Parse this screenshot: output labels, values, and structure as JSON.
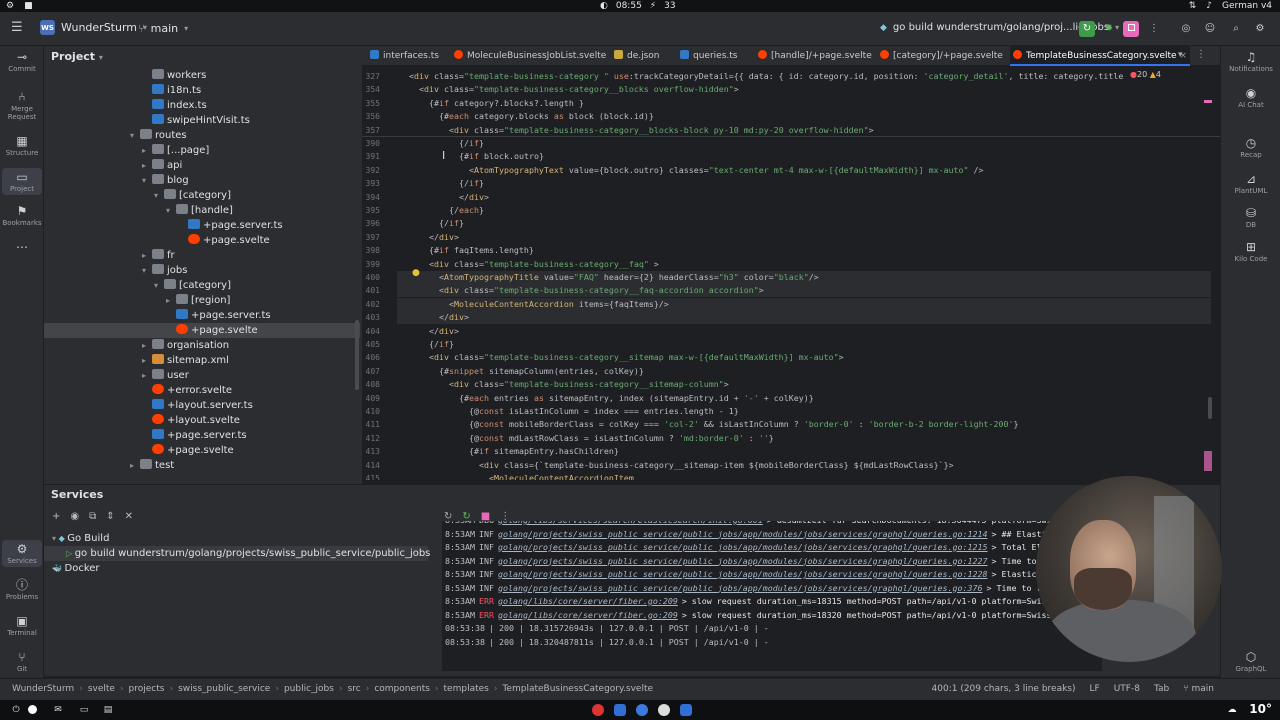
{
  "os_bar": {
    "time": "08:55",
    "counter": "33",
    "keyboard": "German v4"
  },
  "header": {
    "project_badge": "WS",
    "project_name": "WunderSturm",
    "branch": "main",
    "run_config": "go build wunderstrum/golang/proj...lic_jobs"
  },
  "left_tools": [
    {
      "label": "Commit",
      "icon": "commit-icon"
    },
    {
      "label": "Merge Request",
      "icon": "merge-request-icon"
    },
    {
      "label": "Structure",
      "icon": "structure-icon"
    },
    {
      "label": "Project",
      "icon": "folder-icon"
    },
    {
      "label": "Bookmarks",
      "icon": "bookmark-icon"
    }
  ],
  "left_tools_bottom": [
    {
      "label": "Services",
      "icon": "services-icon"
    },
    {
      "label": "Problems",
      "icon": "problems-icon"
    },
    {
      "label": "Terminal",
      "icon": "terminal-icon"
    },
    {
      "label": "Git",
      "icon": "git-icon"
    }
  ],
  "right_tools": [
    {
      "label": "Notifications",
      "icon": "bell-icon"
    },
    {
      "label": "AI Chat",
      "icon": "ai-chat-icon"
    },
    {
      "label": "Recap",
      "icon": "recap-icon"
    },
    {
      "label": "PlantUML",
      "icon": "plantuml-icon"
    },
    {
      "label": "DB",
      "icon": "database-icon"
    },
    {
      "label": "Kilo Code",
      "icon": "kilo-code-icon"
    },
    {
      "label": "GraphQL",
      "icon": "graphql-icon"
    }
  ],
  "project_panel": {
    "title": "Project",
    "tree": [
      {
        "label": "workers",
        "type": "folder",
        "indent": 1,
        "arrow": ""
      },
      {
        "label": "i18n.ts",
        "type": "ts",
        "indent": 1,
        "arrow": ""
      },
      {
        "label": "index.ts",
        "type": "ts",
        "indent": 1,
        "arrow": ""
      },
      {
        "label": "swipeHintVisit.ts",
        "type": "ts",
        "indent": 1,
        "arrow": ""
      },
      {
        "label": "routes",
        "type": "folder",
        "indent": 0,
        "arrow": "▾"
      },
      {
        "label": "[...page]",
        "type": "folder",
        "indent": 1,
        "arrow": "▸"
      },
      {
        "label": "api",
        "type": "folder",
        "indent": 1,
        "arrow": "▸"
      },
      {
        "label": "blog",
        "type": "folder",
        "indent": 1,
        "arrow": "▾"
      },
      {
        "label": "[category]",
        "type": "folder",
        "indent": 2,
        "arrow": "▾"
      },
      {
        "label": "[handle]",
        "type": "folder",
        "indent": 3,
        "arrow": "▾"
      },
      {
        "label": "+page.server.ts",
        "type": "ts",
        "indent": 4,
        "arrow": ""
      },
      {
        "label": "+page.svelte",
        "type": "svelte",
        "indent": 4,
        "arrow": ""
      },
      {
        "label": "fr",
        "type": "folder",
        "indent": 1,
        "arrow": "▸"
      },
      {
        "label": "jobs",
        "type": "folder",
        "indent": 1,
        "arrow": "▾"
      },
      {
        "label": "[category]",
        "type": "folder",
        "indent": 2,
        "arrow": "▾"
      },
      {
        "label": "[region]",
        "type": "folder",
        "indent": 3,
        "arrow": "▸"
      },
      {
        "label": "+page.server.ts",
        "type": "ts",
        "indent": 3,
        "arrow": ""
      },
      {
        "label": "+page.svelte",
        "type": "svelte",
        "indent": 3,
        "arrow": "",
        "selected": true
      },
      {
        "label": "organisation",
        "type": "folder",
        "indent": 1,
        "arrow": "▸"
      },
      {
        "label": "sitemap.xml",
        "type": "xml",
        "indent": 1,
        "arrow": "▸"
      },
      {
        "label": "user",
        "type": "folder",
        "indent": 1,
        "arrow": "▸"
      },
      {
        "label": "+error.svelte",
        "type": "svelte",
        "indent": 1,
        "arrow": ""
      },
      {
        "label": "+layout.server.ts",
        "type": "ts",
        "indent": 1,
        "arrow": ""
      },
      {
        "label": "+layout.svelte",
        "type": "svelte",
        "indent": 1,
        "arrow": ""
      },
      {
        "label": "+page.server.ts",
        "type": "ts",
        "indent": 1,
        "arrow": ""
      },
      {
        "label": "+page.svelte",
        "type": "svelte",
        "indent": 1,
        "arrow": ""
      },
      {
        "label": "test",
        "type": "folder",
        "indent": 0,
        "arrow": "▸"
      }
    ]
  },
  "tabs": [
    {
      "label": "interfaces.ts",
      "type": "ts"
    },
    {
      "label": "MoleculeBusinessJobList.svelte",
      "type": "svelte"
    },
    {
      "label": "de.json",
      "type": "json"
    },
    {
      "label": "queries.ts",
      "type": "ts"
    },
    {
      "label": "[handle]/+page.svelte",
      "type": "svelte"
    },
    {
      "label": "[category]/+page.svelte",
      "type": "svelte"
    },
    {
      "label": "TemplateBusinessCategory.svelte",
      "type": "svelte",
      "active": true
    }
  ],
  "editor": {
    "inspection_errors": "20",
    "inspection_warnings": "4",
    "lines": [
      {
        "n": "327",
        "indent": 0,
        "text": "<div class=\"template-business-category \" use:trackCategoryDetail={{ data: { id: category.id, position: 'category_detail', title: category.title"
      },
      {
        "n": "354",
        "indent": 1,
        "text": "<div class=\"template-business-category__blocks overflow-hidden\">"
      },
      {
        "n": "355",
        "indent": 2,
        "text": "{#if category?.blocks?.length }"
      },
      {
        "n": "356",
        "indent": 3,
        "text": "{#each category.blocks as block (block.id)}"
      },
      {
        "n": "357",
        "indent": 4,
        "text": "<div class=\"template-business-category__blocks-block py-10 md:py-20 overflow-hidden\">"
      },
      {
        "n": "390",
        "indent": 5,
        "text": "{/if}"
      },
      {
        "n": "391",
        "indent": 5,
        "text": "{#if block.outro}"
      },
      {
        "n": "392",
        "indent": 6,
        "text": "<AtomTypographyText value={block.outro} classes=\"text-center mt-4 max-w-[{defaultMaxWidth}] mx-auto\" />"
      },
      {
        "n": "393",
        "indent": 5,
        "text": "{/if}"
      },
      {
        "n": "394",
        "indent": 5,
        "text": "</div>"
      },
      {
        "n": "395",
        "indent": 4,
        "text": "{/each}"
      },
      {
        "n": "396",
        "indent": 3,
        "text": "{/if}"
      },
      {
        "n": "397",
        "indent": 2,
        "text": "</div>"
      },
      {
        "n": "398",
        "indent": 2,
        "text": "{#if faqItems.length}"
      },
      {
        "n": "399",
        "indent": 2,
        "text": "<div class=\"template-business-category__faq\" >"
      },
      {
        "n": "400",
        "indent": 3,
        "text": "<AtomTypographyTitle value=\"FAQ\" header={2} headerClass=\"h3\" color=\"black\"/>",
        "hl": true
      },
      {
        "n": "401",
        "indent": 3,
        "text": "<div class=\"template-business-category__faq-accordion accordion\">",
        "hl": true
      },
      {
        "n": "402",
        "indent": 4,
        "text": "<MoleculeContentAccordion items={faqItems}/>",
        "hl": true
      },
      {
        "n": "403",
        "indent": 3,
        "text": "</div>",
        "hl": true
      },
      {
        "n": "404",
        "indent": 2,
        "text": "</div>"
      },
      {
        "n": "405",
        "indent": 2,
        "text": "{/if}"
      },
      {
        "n": "406",
        "indent": 2,
        "text": "<div class=\"template-business-category__sitemap max-w-[{defaultMaxWidth}] mx-auto\">"
      },
      {
        "n": "407",
        "indent": 3,
        "text": "{#snippet sitemapColumn(entries, colKey)}"
      },
      {
        "n": "408",
        "indent": 4,
        "text": "<div class=\"template-business-category__sitemap-column\">"
      },
      {
        "n": "409",
        "indent": 5,
        "text": "{#each entries as sitemapEntry, index (sitemapEntry.id + '-' + colKey)}"
      },
      {
        "n": "410",
        "indent": 6,
        "text": "{@const isLastInColumn = index === entries.length - 1}"
      },
      {
        "n": "411",
        "indent": 6,
        "text": "{@const mobileBorderClass = colKey === 'col-2' && isLastInColumn ? 'border-0' : 'border-b-2 border-light-200'}"
      },
      {
        "n": "412",
        "indent": 6,
        "text": "{@const mdLastRowClass = isLastInColumn ? 'md:border-0' : ''}"
      },
      {
        "n": "413",
        "indent": 6,
        "text": "{#if sitemapEntry.hasChildren}"
      },
      {
        "n": "414",
        "indent": 7,
        "text": "<div class={`template-business-category__sitemap-item ${mobileBorderClass} ${mdLastRowClass}`}>"
      },
      {
        "n": "415",
        "indent": 8,
        "text": "<MoleculeContentAccordionItem"
      }
    ]
  },
  "services_panel": {
    "title": "Services",
    "items": [
      {
        "label": "Go Build",
        "indent": 0,
        "arrow": "▾"
      },
      {
        "label": "go build wunderstrum/golang/projects/swiss_public_service/public_jobs",
        "indent": 1,
        "arrow": "",
        "selected": true
      },
      {
        "label": "Docker",
        "indent": 0,
        "arrow": ""
      }
    ],
    "logs": [
      {
        "time": "8:53AM",
        "level": "DBG",
        "path": "golang/libs/services/search/elasticsearch/init.go:601",
        "msg": "> Gesamtzeit für SearchDocuments: 18.3644475 platform=Swis"
      },
      {
        "time": "8:53AM",
        "level": "INF",
        "path": "golang/projects/swiss_public_service/public_jobs/app/modules/jobs/services/graphql/queries.go:1214",
        "msg": "> ## Elasticsearch"
      },
      {
        "time": "8:53AM",
        "level": "INF",
        "path": "golang/projects/swiss_public_service/public_jobs/app/modules/jobs/services/graphql/queries.go:1215",
        "msg": "> Total Elastics"
      },
      {
        "time": "8:53AM",
        "level": "INF",
        "path": "golang/projects/swiss_public_service/public_jobs/app/modules/jobs/services/graphql/queries.go:1227",
        "msg": "> Time to proc"
      },
      {
        "time": "8:53AM",
        "level": "INF",
        "path": "golang/projects/swiss_public_service/public_jobs/app/modules/jobs/services/graphql/queries.go:1228",
        "msg": "> Elasticsearch"
      },
      {
        "time": "8:53AM",
        "level": "INF",
        "path": "golang/projects/swiss_public_service/public_jobs/app/modules/jobs/services/graphql/queries.go:376",
        "msg": "> Time to resolve"
      },
      {
        "time": "8:53AM",
        "level": "ERR",
        "path": "golang/libs/core/server/fiber.go:209",
        "msg": "> slow request duration_ms=18315 method=POST path=/api/v1-0 platform=SwissPubl"
      },
      {
        "time": "8:53AM",
        "level": "ERR",
        "path": "golang/libs/core/server/fiber.go:209",
        "msg": "> slow request duration_ms=18320 method=POST path=/api/v1-0 platform=SwissPubl"
      },
      {
        "time": "08:53:38",
        "level": "",
        "path": "",
        "msg": "| 200 | 18.315726943s | 127.0.0.1 | POST | /api/v1-0 | -"
      },
      {
        "time": "08:53:38",
        "level": "",
        "path": "",
        "msg": "| 200 | 18.320487811s | 127.0.0.1 | POST | /api/v1-0 | -"
      }
    ]
  },
  "status_bar": {
    "breadcrumbs": [
      "WunderSturm",
      "svelte",
      "projects",
      "swiss_public_service",
      "public_jobs",
      "src",
      "components",
      "templates",
      "TemplateBusinessCategory.svelte"
    ],
    "position": "400:1 (209 chars, 3 line breaks)",
    "line_ending": "LF",
    "encoding": "UTF-8",
    "indent": "Tab",
    "branch": "main"
  },
  "taskbar": {
    "temperature": "10°"
  },
  "colors": {
    "accent": "#3574f0",
    "svelte": "#ff3e00",
    "ts": "#3178c6",
    "error": "#f75464",
    "run_green": "#3e9b4a",
    "stop_pink": "#e66ab9"
  }
}
